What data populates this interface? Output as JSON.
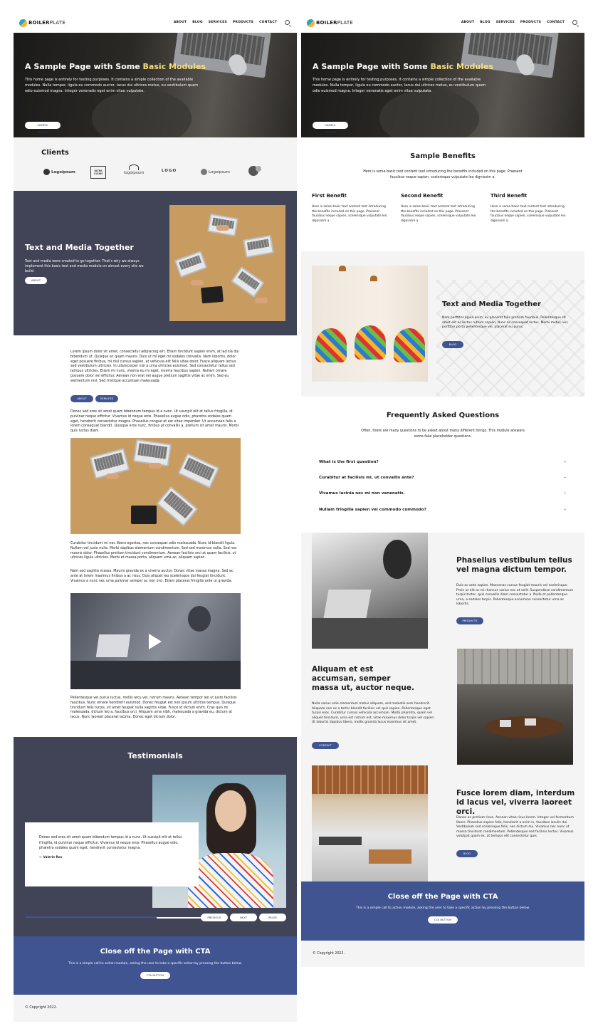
{
  "brand": {
    "part1": "BOILER",
    "part2": "PLATE"
  },
  "nav": [
    "ABOUT",
    "BLOG",
    "SERVICES",
    "PRODUCTS",
    "CONTACT"
  ],
  "hero": {
    "title_start": "A Sample Page with Some ",
    "title_highlight": "Basic Modules",
    "text": "This home page is entirely for testing purposes. It contains a simple collection of the available modules. Nulla tempor, ligula eu commodo auctor, lacus dui ultrices metus, eu vestibulum quam odio euismod magna. Integer venenatis eget enim vitae vulputate.",
    "button": "SAMPLE BUTTON"
  },
  "clients": {
    "title": "Clients",
    "logos": [
      "Logoipsum",
      "ULTRA CLEAN",
      "logoipsum",
      "LOGO",
      "Logoipsum",
      ""
    ]
  },
  "tm_left": {
    "title": "Text and Media Together",
    "text": "Text and media were created to go together. That's why we always implement this basic text and media module on almost every site we build.",
    "button": "ABOUT"
  },
  "content": {
    "p1": "Lorem ipsum dolor sit amet, consectetur adipiscing elit. Etiam tincidunt sapien enim, at lacinia dui bibendum ut. Quisque ac quam mauris. Duis ut mi eget mi sodales convallis. Nam lobortis, dolor eget posuere finibus, mi nisl cursus sapien, at vehicula elit felis vitae dolor. Fusce aliquam lectus sed vestibulum ultricies. In ullamcorper nisl a urna ultricies euismod. Sed consectetur tellus sed tempus ultricies. Etiam mi nunc, viverra eu mi eget, viverra faucibus sapien. Nullam ornare posuere dolor vel efficitur. Aenean non erat vel augue pretium sagittis vitae ac enim. Sed eu elementum nisl. Sed tristique accumsan malesuada.",
    "btn1": "ABOUT",
    "btn2": "SERVICES",
    "p2": "Donec sed eros sit amet quam bibendum tempus id a nunc. Ut suscipit elit et tellus fringilla, id pulvinar neque efficitur. Vivamus id neque eros. Phasellus augue odio, pharetra sodales quam eget, hendrerit consectetur magna. Phasellus congue et est vitae imperdiet. Ut accumsan felis a lorem consequat blandit. Quisque eros nunc, finibus at convallis a, pretium sit amet mauris. Morbi quis luctus diam.",
    "p3": "Curabitur tincidunt mi nec libero egestas, nec consequat odio malesuada. Nunc id blandit ligula. Nullam vel justo nulla. Morbi dapibus elementum condimentum. Sed sed maximus nulla. Sed nec mauris dolor. Phasellus pretium tincidunt condimentum. Aenean facilisis orci at quam facilisis, ut ultrices ligula ultricies. Morbi et massa porta, aliquam urna ac, aliquam sapien.",
    "p4": "Nam sed sagittis massa. Mauris gravida ex a viverra auctor. Donec vitae massa magna. Sed ac ante at lorem maximus finibus a ac risus. Duis aliquet leo scelerisque dui feugiat tincidunt. Vivamus a nunc nec urna pulvinar semper ac non orci. Etiam placerat fringilla ante ut gravida.",
    "p5": "Pellentesque vel purus luctus, mollis arcu vel, rutrum mauris. Aenean tempor leo ut justo facilisis faucibus. Nunc ornare hendrerit euismod. Donec feugiat est non ipsum ultrices tempus. Quisque tincidunt felis turpis, sit amet feugiat nulla sagittis vitae. Fusce id dictum enim. Cras quis mi malesuada, dictum leo a, faucibus orci. Aliquam urna nibh, malesuada a gravida eu, dictum at lacus. Nunc laoreet placerat lacinia. Donec eget dictum dolor."
  },
  "testimonials": {
    "title": "Testimonials",
    "quote": "Donec sed eros sit amet quam bibendum tempus id a nunc. Ut suscipit elit et tellus fringilla, id pulvinar neque efficitur. Vivamus id neque eros. Phasellus augue odio, pharetra sodales quam eget, hendrerit consectetur magna.",
    "author": "— Valerie Ros",
    "controls": [
      "PREVIOUS",
      "NEXT",
      "PAUSE"
    ],
    "progress": 0.73
  },
  "cta": {
    "title": "Close off the Page with CTA",
    "text": "This is a simple call to action module, asking the user to take a specific action by pressing the button below.",
    "button": "CTA BUTTON"
  },
  "footer": "© Copyright 2022.",
  "benefits": {
    "title": "Sample Benefits",
    "intro": "Here is some basic text content text introducing the benefits included on this page. Praesent faucibus neque sapien, scelerisque vulputate leo dignissim a.",
    "items": [
      {
        "title": "First Benefit",
        "text": "Here is some basic text content text introducing the benefits included on this page. Praesent faucibus neque sapien, scelerisque vulputate leo dignissim a."
      },
      {
        "title": "Second Benefit",
        "text": "Here is some basic text content text introducing the benefits included on this page. Praesent faucibus neque sapien, scelerisque vulputate leo dignissim a."
      },
      {
        "title": "Third Benefit",
        "text": "Here is some basic text content text introducing the benefits included on this page. Praesent faucibus neque sapien, scelerisque vulputate leo dignissim a."
      }
    ]
  },
  "tm_right": {
    "title": "Text and Media Together",
    "text": "Nam porttitor ligula enim, eu placerat felis pretium faucibus. Pellentesque sit amet elit ac lectus rutrum sapien. Nunc ac consequat lectus. Morbi metus nisl, porttitor porta pellentesque vel, placerat eu purus.",
    "button": "BLOG"
  },
  "faq": {
    "title": "Frequently Asked Questions",
    "intro": "Often, there are many questions to be asked about many different things. This module answers some fake placeholder questions.",
    "items": [
      "What is the first question?",
      "Curabitur at facilisis mi, ut convallis ante?",
      "Vivamus lacinia nec mi non venenatis.",
      "Nullam fringilla sapien vel commodo commodo?"
    ],
    "toggle": "+"
  },
  "zigzag": [
    {
      "title": "Phasellus vestibulum tellus vel magna dictum tempor.",
      "text": "Duis ac ante sapien. Maecenas cursus feugiat mauris vel scelerisque. Proin ut elit ac mi rhoncus varius nec at velit. Suspendisse condimentum turpis tortor, quis convallis diam consectetur a. Nulla et pellentesque urna, a sodales turpis. Pellentesque accumsan consectetur urna ac lobortis.",
      "button": "PRODUCTS"
    },
    {
      "title": "Aliquam et est accumsan, semper massa ut, auctor neque.",
      "text": "Nulla varius odio elementum metus aliquam, sed molestie sem hendrerit. Aliquam non ex a tortor blandit facilisis vel quis sapien. Pellentesque eget turpis eros. Curabitur cursus vehicula accumsan. Morbi pharetra, quam vel aliquet tincidunt, urna est rutrum est, vitae maximus dolor turpis vel sapien. Ut lobortis dapibus libero, mollis gravida lacus maximus sit amet.",
      "button": "CONTACT"
    },
    {
      "title": "Fusce lorem diam, interdum id lacus vel, viverra laoreet orci.",
      "text": "Donec ac pretium risus. Aenean vitae risus lorem. Integer vel fermentum libero. Phasellus sapien felis, hendrerit a enim in, faucibus iaculis dui. Vestibulum sed scelerisque felis, nec dictum dui. Vivamus nec nunc ut massa tincidunt condimentum. Pellentesque sed facilisis lectus. Vivamus volutpat quam ex, at tempus elit consectetur quis.",
      "button": "BLOG"
    }
  ],
  "colors": {
    "dark_section": "#414356",
    "accent": "#3f5490",
    "highlight": "#f7df7c",
    "light_bg": "#f4f4f4"
  },
  "icons": [
    "search-icon",
    "play-icon",
    "plus-icon"
  ]
}
